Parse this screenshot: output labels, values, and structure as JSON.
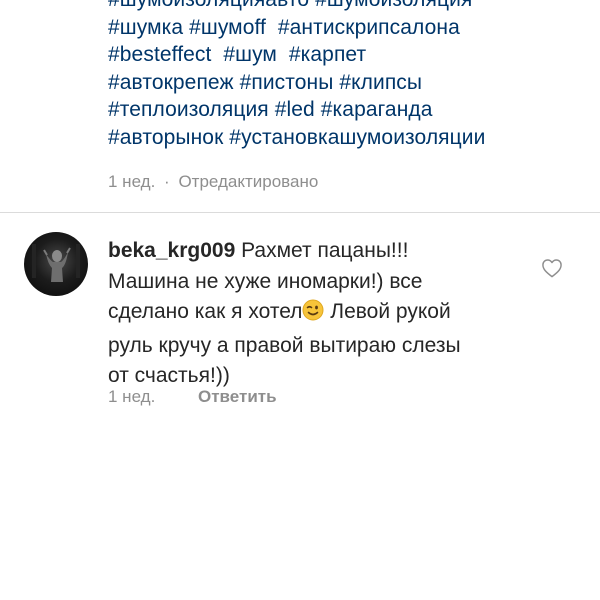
{
  "post": {
    "caption_lines": [
      [
        "#шумоизоляцияавто",
        "#шумоизоляция"
      ],
      [
        "#шумка",
        "#шумoff",
        "#антискрипсалона"
      ],
      [
        "#besteffect",
        "#шум",
        "#карпет"
      ],
      [
        "#автокрепеж",
        "#пистоны",
        "#клипсы"
      ],
      [
        "#теплоизоляция",
        "#led",
        "#караганда"
      ],
      [
        "#авторынок",
        "#установкашумоизоляции"
      ]
    ],
    "age": "1 нед.",
    "separator": "·",
    "edited": "Отредактировано"
  },
  "comment": {
    "username": "beka_krg009",
    "text_lines": [
      "Рахмет пацаны!!!",
      "Машина не хуже иномарки!) все",
      "сделано как я хотел",
      "Левой рукой",
      "руль кручу а правой вытираю слезы",
      "от счастья!))"
    ],
    "age": "1 нед.",
    "reply_label": "Ответить",
    "emoji": "winking-face"
  },
  "colors": {
    "hashtag": "#003569",
    "text": "#262626",
    "meta": "#8e8e8e",
    "divider": "#dbdbdb"
  }
}
